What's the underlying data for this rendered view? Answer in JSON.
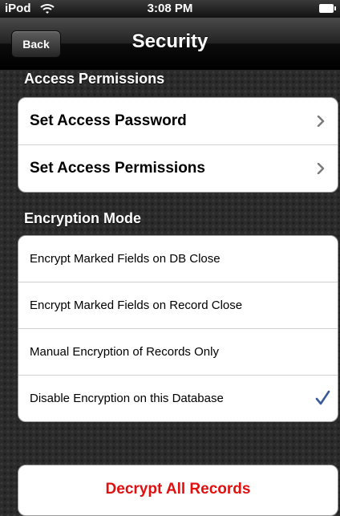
{
  "status_bar": {
    "carrier": "iPod",
    "wifi_icon": "wifi-icon",
    "time": "3:08 PM",
    "battery_icon": "battery-icon"
  },
  "nav_bar": {
    "back_label": "Back",
    "title": "Security"
  },
  "access_permissions": {
    "header": "Access Permissions",
    "items": [
      {
        "label": "Set Access Password",
        "icon": "chevron-right-icon"
      },
      {
        "label": "Set Access Permissions",
        "icon": "chevron-right-icon"
      }
    ]
  },
  "encryption_mode": {
    "header": "Encryption Mode",
    "selected": "Disable Encryption on this Database",
    "check_color": "#3a5b9b",
    "items": [
      {
        "label": "Encrypt Marked Fields on DB Close"
      },
      {
        "label": "Encrypt Marked Fields on Record Close"
      },
      {
        "label": "Manual Encryption of Records Only"
      },
      {
        "label": "Disable Encryption on this Database",
        "icon": "checkmark-icon"
      }
    ]
  },
  "actions": {
    "decrypt_label": "Decrypt All Records",
    "decrypt_color": "#e01010"
  }
}
